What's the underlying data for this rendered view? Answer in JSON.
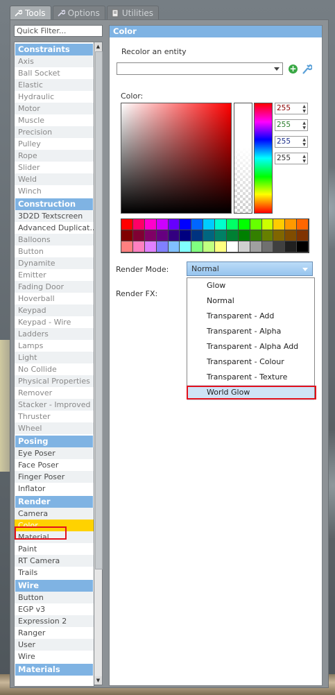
{
  "tabs": [
    {
      "label": "Tools",
      "icon": "wrench-icon",
      "active": true
    },
    {
      "label": "Options",
      "icon": "wrench-icon",
      "active": false
    },
    {
      "label": "Utilities",
      "icon": "document-icon",
      "active": false
    }
  ],
  "filter": {
    "placeholder": "Quick Filter..."
  },
  "categories": [
    {
      "name": "Constraints",
      "items": [
        "Axis",
        "Ball Socket",
        "Elastic",
        "Hydraulic",
        "Motor",
        "Muscle",
        "Precision",
        "Pulley",
        "Rope",
        "Slider",
        "Weld",
        "Winch"
      ]
    },
    {
      "name": "Construction",
      "items": [
        "3D2D Textscreen",
        "Advanced Duplicat...",
        "Balloons",
        "Button",
        "Dynamite",
        "Emitter",
        "Fading Door",
        "Hoverball",
        "Keypad",
        "Keypad - Wire",
        "Ladders",
        "Lamps",
        "Light",
        "No Collide",
        "Physical Properties",
        "Remover",
        "Stacker - Improved",
        "Thruster",
        "Wheel"
      ]
    },
    {
      "name": "Posing",
      "items": [
        "Eye Poser",
        "Face Poser",
        "Finger Poser",
        "Inflator"
      ]
    },
    {
      "name": "Render",
      "items": [
        "Camera",
        "Color",
        "Material",
        "Paint",
        "RT Camera",
        "Trails"
      ]
    },
    {
      "name": "Wire",
      "items": [
        "Button",
        "EGP v3",
        "Expression 2",
        "Ranger",
        "User",
        "Wire"
      ]
    },
    {
      "name": "Materials",
      "items": []
    }
  ],
  "selected_item": "Color",
  "panel": {
    "title": "Color",
    "recolor_label": "Recolor an entity",
    "color_label": "Color:",
    "rgba": [
      "255",
      "255",
      "255",
      "255"
    ],
    "rgba_colors": [
      "#8b0000",
      "#2a7d2a",
      "#1b2e8a",
      "#333333"
    ],
    "render_mode_label": "Render Mode:",
    "render_mode_value": "Normal",
    "render_fx_label": "Render FX:",
    "render_mode_options": [
      "Glow",
      "Normal",
      "Transparent - Add",
      "Transparent - Alpha",
      "Transparent - Alpha Add",
      "Transparent - Colour",
      "Transparent - Texture",
      "World Glow"
    ],
    "highlighted_option": "World Glow"
  },
  "palette": [
    "#ff0000",
    "#ff0066",
    "#ff00cc",
    "#cc00ff",
    "#6600ff",
    "#0000ff",
    "#0066ff",
    "#00ccff",
    "#00ffcc",
    "#00ff66",
    "#00ff00",
    "#66ff00",
    "#ccff00",
    "#ffcc00",
    "#ff9900",
    "#ff6600",
    "#800000",
    "#800033",
    "#800066",
    "#660080",
    "#330080",
    "#000080",
    "#003380",
    "#006680",
    "#008066",
    "#008033",
    "#008000",
    "#338000",
    "#668000",
    "#806600",
    "#804c00",
    "#803300",
    "#ff8080",
    "#ff80c0",
    "#e080ff",
    "#8080ff",
    "#80c0ff",
    "#80ffff",
    "#80ff80",
    "#c0ff80",
    "#ffff80",
    "#ffffff",
    "#d0d0d0",
    "#a0a0a0",
    "#707070",
    "#404040",
    "#202020",
    "#000000"
  ]
}
